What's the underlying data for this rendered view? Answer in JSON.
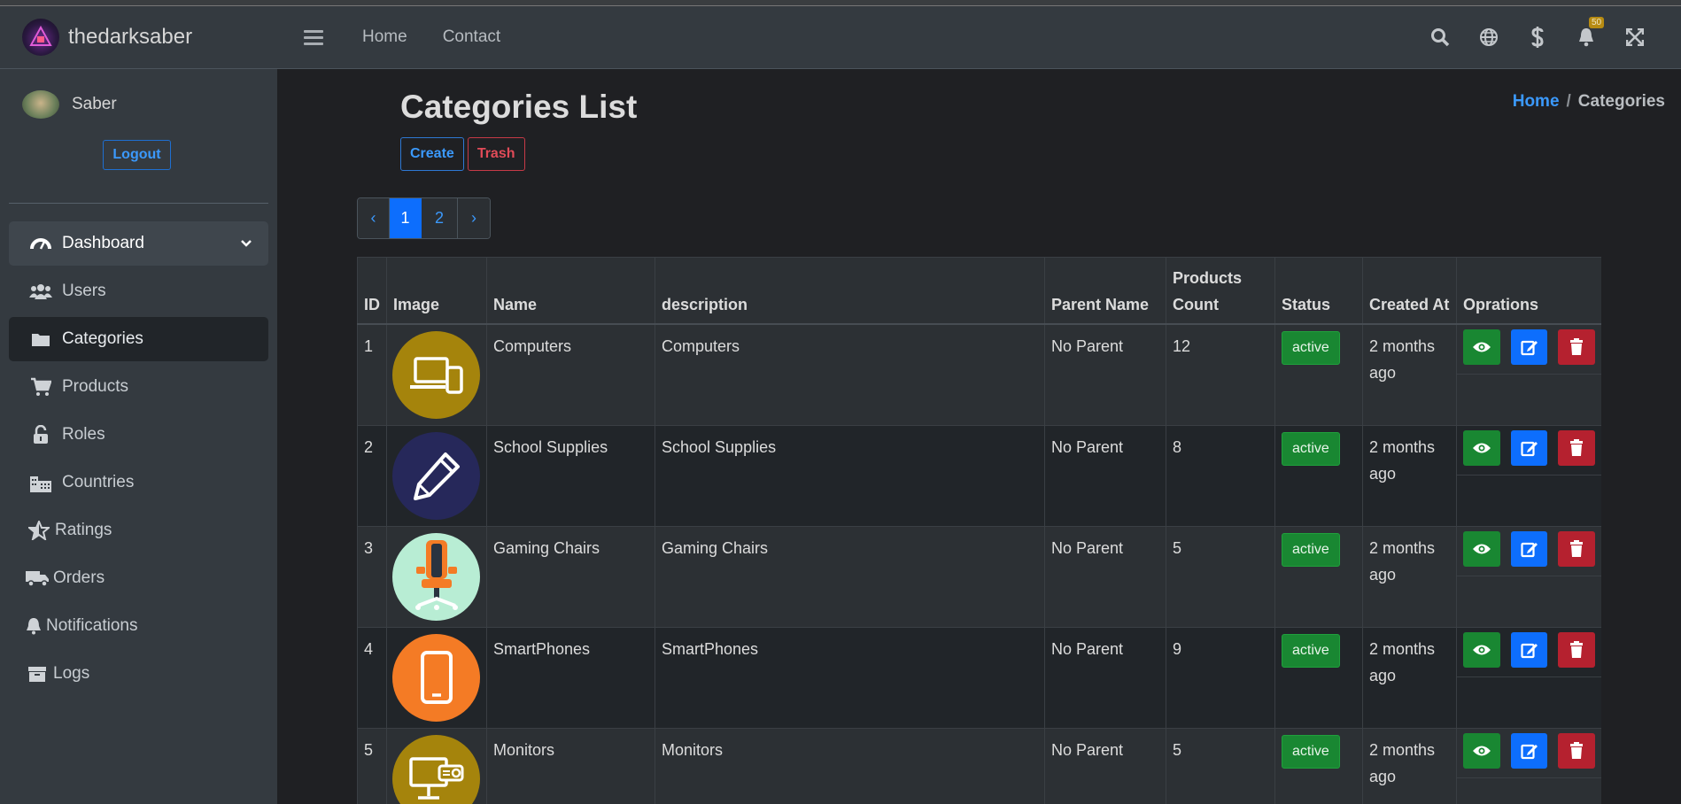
{
  "brand": {
    "name": "thedarksaber"
  },
  "user": {
    "name": "Saber",
    "logout_label": "Logout"
  },
  "sidebar": {
    "items": [
      {
        "label": "Dashboard",
        "icon": "dashboard-icon"
      },
      {
        "label": "Users",
        "icon": "users-icon"
      },
      {
        "label": "Categories",
        "icon": "folder-icon"
      },
      {
        "label": "Products",
        "icon": "cart-icon"
      },
      {
        "label": "Roles",
        "icon": "unlock-icon"
      },
      {
        "label": "Countries",
        "icon": "city-icon"
      },
      {
        "label": "Ratings",
        "icon": "star-icon"
      },
      {
        "label": "Orders",
        "icon": "truck-icon"
      },
      {
        "label": "Notifications",
        "icon": "bell-icon"
      },
      {
        "label": "Logs",
        "icon": "archive-icon"
      }
    ]
  },
  "topnav": {
    "links": [
      "Home",
      "Contact"
    ],
    "notification_count": "50"
  },
  "page": {
    "title": "Categories List",
    "breadcrumb": {
      "home": "Home",
      "separator": "/",
      "current": "Categories"
    },
    "create_label": "Create",
    "trash_label": "Trash"
  },
  "pagination": {
    "prev": "‹",
    "pages": [
      "1",
      "2"
    ],
    "next": "›",
    "current": "1"
  },
  "table": {
    "headers": [
      "ID",
      "Image",
      "Name",
      "description",
      "Parent Name",
      "Products Count",
      "Status",
      "Created At",
      "Oprations"
    ],
    "rows": [
      {
        "id": "1",
        "name": "Computers",
        "description": "Computers",
        "parent": "No Parent",
        "count": "12",
        "status": "active",
        "created": "2 months ago",
        "image_color": "#a5840c",
        "image_icon": "laptop-phone-icon"
      },
      {
        "id": "2",
        "name": "School Supplies",
        "description": "School Supplies",
        "parent": "No Parent",
        "count": "8",
        "status": "active",
        "created": "2 months ago",
        "image_color": "#26285a",
        "image_icon": "pencil-icon"
      },
      {
        "id": "3",
        "name": "Gaming Chairs",
        "description": "Gaming Chairs",
        "parent": "No Parent",
        "count": "5",
        "status": "active",
        "created": "2 months ago",
        "image_color": "#b8edd4",
        "image_icon": "gaming-chair-icon"
      },
      {
        "id": "4",
        "name": "SmartPhones",
        "description": "SmartPhones",
        "parent": "No Parent",
        "count": "9",
        "status": "active",
        "created": "2 months ago",
        "image_color": "#f47b25",
        "image_icon": "smartphone-icon"
      },
      {
        "id": "5",
        "name": "Monitors",
        "description": "Monitors",
        "parent": "No Parent",
        "count": "5",
        "status": "active",
        "created": "2 months ago",
        "image_color": "#a5840c",
        "image_icon": "monitor-projector-icon"
      }
    ]
  },
  "colors": {
    "accent": "#0d6efd",
    "success": "#198732",
    "danger": "#b5212f",
    "sidebar": "#343a40"
  }
}
